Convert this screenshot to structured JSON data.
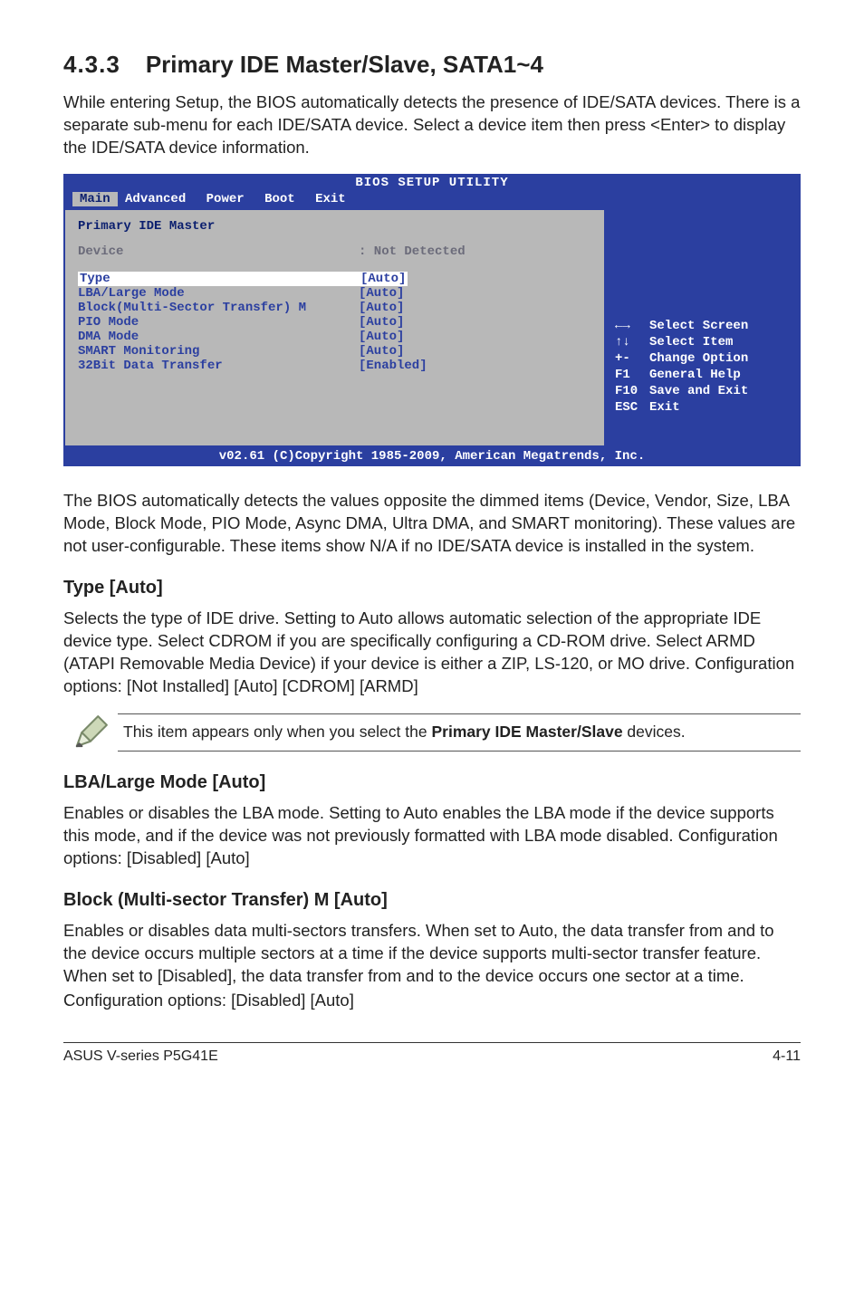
{
  "section": {
    "number": "4.3.3",
    "title": "Primary IDE Master/Slave, SATA1~4"
  },
  "intro": "While entering Setup, the BIOS automatically detects the presence of IDE/SATA devices. There is a separate sub-menu for each IDE/SATA device. Select a device item then press <Enter> to display the IDE/SATA device information.",
  "bios": {
    "utility_title": "BIOS SETUP UTILITY",
    "tabs": {
      "main": "Main",
      "advanced": "Advanced",
      "power": "Power",
      "boot": "Boot",
      "exit": "Exit"
    },
    "panel_title": "Primary IDE Master",
    "device_label": "Device",
    "device_value": ": Not Detected",
    "rows": [
      {
        "label": "Type",
        "value": "[Auto]",
        "hl": true
      },
      {
        "label": "LBA/Large Mode",
        "value": "[Auto]"
      },
      {
        "label": "Block(Multi-Sector Transfer) M",
        "value": "[Auto]"
      },
      {
        "label": "PIO Mode",
        "value": "[Auto]"
      },
      {
        "label": "DMA Mode",
        "value": "[Auto]"
      },
      {
        "label": "SMART Monitoring",
        "value": "[Auto]"
      },
      {
        "label": "32Bit Data Transfer",
        "value": "[Enabled]"
      }
    ],
    "help": [
      {
        "k": "←→",
        "t": "Select Screen"
      },
      {
        "k": "↑↓",
        "t": "Select Item"
      },
      {
        "k": "+-",
        "t": "Change Option"
      },
      {
        "k": "F1",
        "t": "General Help"
      },
      {
        "k": "F10",
        "t": "Save and Exit"
      },
      {
        "k": "ESC",
        "t": "Exit"
      }
    ],
    "copyright": "v02.61 (C)Copyright 1985-2009, American Megatrends, Inc."
  },
  "after_bios": "The BIOS automatically detects the values opposite the dimmed items (Device, Vendor, Size, LBA Mode, Block Mode, PIO Mode, Async DMA, Ultra DMA, and SMART monitoring). These values are not user-configurable. These items show N/A if no IDE/SATA device is installed in the system.",
  "type": {
    "heading": "Type [Auto]",
    "text": "Selects the type of IDE drive. Setting to Auto allows automatic selection of the appropriate IDE device type. Select CDROM if you are specifically configuring a CD-ROM drive. Select ARMD (ATAPI Removable Media Device) if your device is either a ZIP, LS-120, or MO drive. Configuration options: [Not Installed] [Auto] [CDROM] [ARMD]"
  },
  "note": {
    "pre": "This item appears only when you select the ",
    "bold": "Primary IDE Master/Slave",
    "post": " devices."
  },
  "lba": {
    "heading": "LBA/Large Mode [Auto]",
    "text": "Enables or disables the LBA mode. Setting to Auto enables the LBA mode if the device supports this mode, and if the device was not previously formatted with LBA mode disabled. Configuration options: [Disabled] [Auto]"
  },
  "block": {
    "heading": "Block (Multi-sector Transfer) M [Auto]",
    "text1": "Enables or disables data multi-sectors transfers. When set to Auto, the data transfer from and to the device occurs multiple sectors at a time if the device supports multi-sector transfer feature. When set to [Disabled], the data transfer from and to the device occurs one sector at a time.",
    "text2": "Configuration options: [Disabled] [Auto]"
  },
  "footer": {
    "left": "ASUS V-series P5G41E",
    "right": "4-11"
  }
}
